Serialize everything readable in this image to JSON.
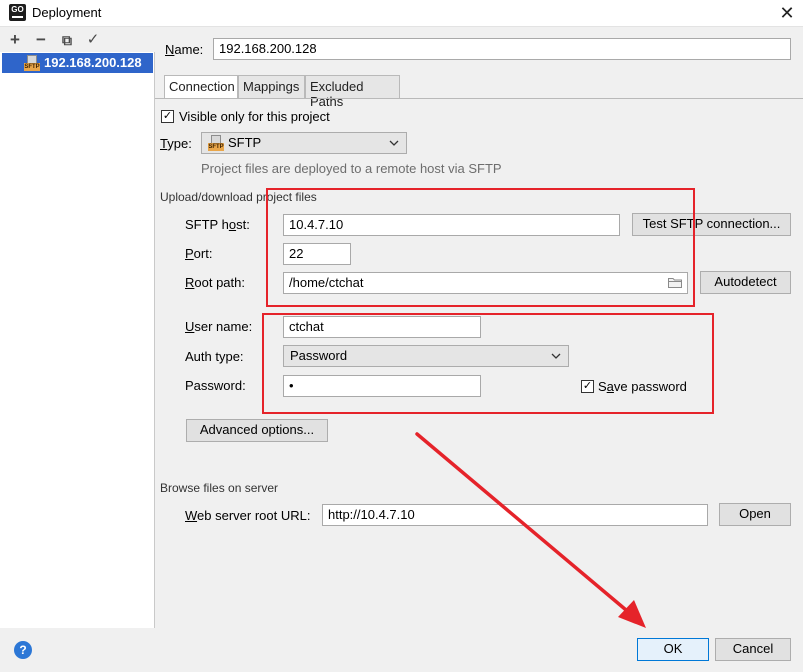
{
  "window": {
    "title": "Deployment",
    "icon_text": "GO",
    "close_glyph": "✕"
  },
  "toolbar": {
    "add": "+",
    "remove": "−",
    "copy": "⧉",
    "apply": "✓"
  },
  "server_list": {
    "items": [
      {
        "label": "192.168.200.128",
        "icon": "sftp-icon",
        "selected": true
      }
    ]
  },
  "name": {
    "label": "Name:",
    "value": "192.168.200.128"
  },
  "tabs": [
    {
      "label": "Connection",
      "active": true
    },
    {
      "label": "Mappings",
      "active": false
    },
    {
      "label": "Excluded Paths",
      "active": false
    }
  ],
  "connection": {
    "visible_only_label": "Visible only for this project",
    "visible_only_checked": true,
    "type_label": "Type:",
    "type_value": "SFTP",
    "type_icon_text": "SFTP",
    "type_hint": "Project files are deployed to a remote host via SFTP",
    "upload_group_title": "Upload/download project files",
    "sftp_host_label": "SFTP host:",
    "sftp_host_value": "10.4.7.10",
    "test_button": "Test SFTP connection...",
    "port_label": "Port:",
    "port_value": "22",
    "root_path_label": "Root path:",
    "root_path_value": "/home/ctchat",
    "autodetect_button": "Autodetect",
    "user_name_label": "User name:",
    "user_name_value": "ctchat",
    "auth_type_label": "Auth type:",
    "auth_type_value": "Password",
    "password_label": "Password:",
    "password_value": "•",
    "save_password_label": "Save password",
    "save_password_checked": true,
    "advanced_button": "Advanced options...",
    "browse_group_title": "Browse files on server",
    "web_root_label": "Web server root URL:",
    "web_root_value": "http://10.4.7.10",
    "open_button": "Open"
  },
  "footer": {
    "help": "?",
    "ok": "OK",
    "cancel": "Cancel"
  },
  "colors": {
    "selection": "#2f65ca",
    "annotation": "#e5232a",
    "ok_border": "#0078d7"
  }
}
